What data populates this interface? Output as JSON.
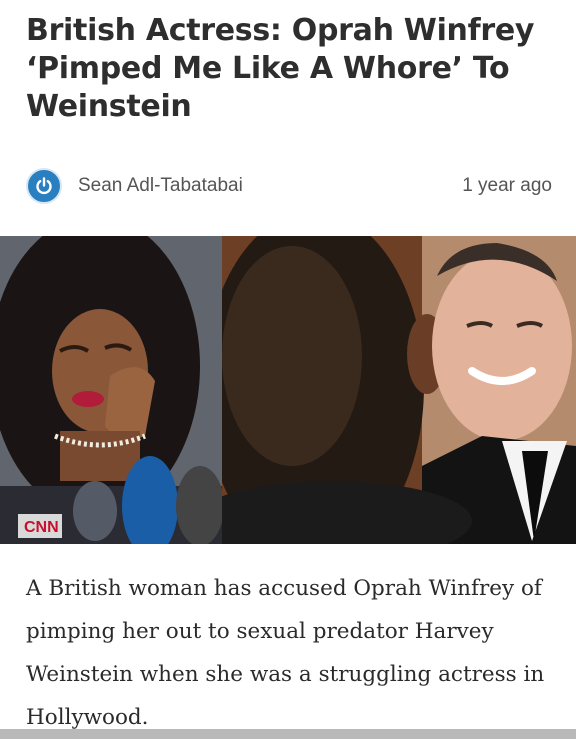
{
  "article": {
    "headline": "British Actress: Oprah Winfrey ‘Pimped Me Like A Whore’ To Weinstein",
    "author": "Sean Adl-Tabatabai",
    "time_ago": "1 year ago",
    "body": "A British woman has accused Oprah Winfrey of pimping her out to sexual predator Harvey Weinstein when she was a struggling actress in Hollywood.",
    "photo_caption_logo": "CNN"
  },
  "icons": {
    "author_avatar": "power-icon"
  },
  "colors": {
    "avatar_blue": "#2a7fc1",
    "headline": "#2e2e2e"
  }
}
